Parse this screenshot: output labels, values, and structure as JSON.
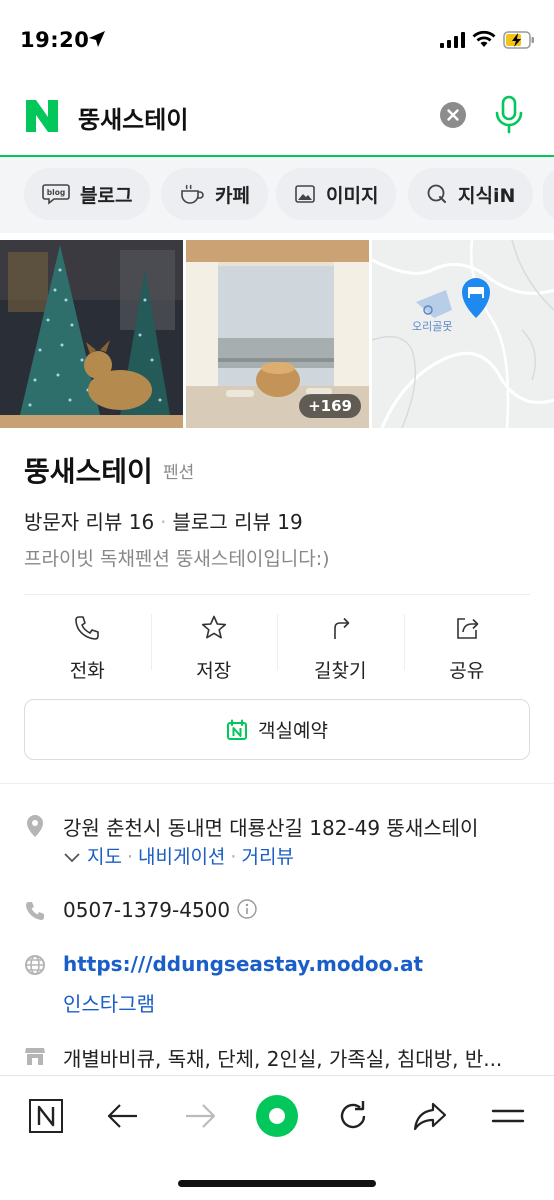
{
  "status_bar": {
    "time": "19:20",
    "icons": [
      "location-arrow-icon",
      "signal-icon",
      "wifi-icon",
      "battery-charging-icon"
    ]
  },
  "search": {
    "logo_letter": "N",
    "query": "뚱새스테이",
    "brand_color": "#03c75a"
  },
  "chips": [
    {
      "label": "블로그",
      "icon": "blog-icon",
      "icon_text": "blog"
    },
    {
      "label": "카페",
      "icon": "cup-icon"
    },
    {
      "label": "이미지",
      "icon": "image-icon"
    },
    {
      "label": "지식iN",
      "icon": "search-q-icon"
    }
  ],
  "photos": {
    "more_count": "+169",
    "map_label": "오리골못"
  },
  "place": {
    "name": "뚱새스테이",
    "category": "펜션",
    "visitor_reviews": "방문자 리뷰 16",
    "blog_reviews": "블로그 리뷰 19",
    "tagline": "프라이빗 독채펜션 뚱새스테이입니다:)"
  },
  "actions": [
    {
      "label": "전화",
      "icon": "phone-icon"
    },
    {
      "label": "저장",
      "icon": "star-icon"
    },
    {
      "label": "길찾기",
      "icon": "directions-icon"
    },
    {
      "label": "공유",
      "icon": "share-icon"
    }
  ],
  "reserve": {
    "label": "객실예약",
    "icon": "naver-booking-icon"
  },
  "details": {
    "address": "강원 춘천시 동내면 대룡산길 182-49 뚱새스테이",
    "address_links": [
      "지도",
      "내비게이션",
      "거리뷰"
    ],
    "phone": "0507-1379-4500",
    "website": "https:///ddungseastay.modoo.at",
    "instagram": "인스타그램",
    "amenities": "개별바비큐, 독채, 단체, 2인실, 가족실, 침대방, 반..."
  },
  "toolbar": {
    "items": [
      "naver-home-icon",
      "back-icon",
      "forward-icon",
      "green-dot-icon",
      "reload-icon",
      "share-arrow-icon",
      "menu-icon"
    ]
  }
}
